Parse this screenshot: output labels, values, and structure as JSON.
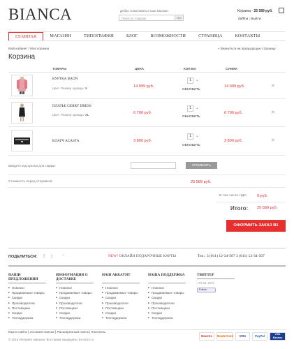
{
  "header": {
    "logo": "BIANCA",
    "welcome": "Добро пожаловать в наш магазин",
    "search_placeholder": "Поиск по товарам",
    "search_button": "GO",
    "cart_label": "Корзина -",
    "cart_total": "25 589 руб.",
    "user_name": "daffina",
    "logout": "Выйти"
  },
  "nav": {
    "items": [
      "ГЛАВНАЯ",
      "МАГАЗИН",
      "ТИПОГРАФИЯ",
      "БЛОГ",
      "ВОЗМОЖНОСТИ",
      "СТРАНИЦА",
      "КОНТАКТЫ"
    ]
  },
  "breadcrumb": "Мой кабинет / Моя корзина",
  "back_link": "« Вернуться на предыдущую страницу",
  "title": "Корзина",
  "table": {
    "headers": [
      "ТОВАРЫ",
      "ЦЕНА",
      "КОЛ-ВО",
      "СУММА"
    ],
    "rows": [
      {
        "name": "КУРТКА BAON",
        "meta_label": "Цвет: Размер одежды:",
        "meta_value": "S",
        "price": "14 999 руб.",
        "qty": "1",
        "plus": "+",
        "update": "ОБНОВИТЬ",
        "sum": "14 999 руб.",
        "remove": "✕"
      },
      {
        "name": "ПЛАТЬЕ GERRY DRESS",
        "meta_label": "Цвет: Размер одежды:",
        "meta_value": "XL",
        "price": "6 700 руб.",
        "qty": "1",
        "plus": "+",
        "update": "ОБНОВИТЬ",
        "sum": "6 700 руб.",
        "remove": "✕"
      },
      {
        "name": "КЛАТЧ ACASTA",
        "meta_label": "",
        "meta_value": "",
        "price": "3 890 руб.",
        "qty": "1",
        "plus": "+",
        "update": "ОБНОВИТЬ",
        "sum": "3 890 руб.",
        "remove": "✕"
      }
    ]
  },
  "coupon": {
    "label": "Введите код купона для скидки:",
    "placeholder": "",
    "apply": "ПРИМЕНИТЬ"
  },
  "summary": {
    "before_label": "Стоимость перед отправкой",
    "before_value": "25 589 руб.",
    "vat_label": "В том числе НДС:",
    "vat_value": "0 руб.",
    "total_label": "Итого:",
    "total_value": "25 589 руб.",
    "checkout": "ОФОРМИТЬ ЗАКАЗ В1"
  },
  "share": {
    "label": "ПОДЕЛИТЬСЯ:",
    "icons": [
      "f",
      "t",
      "rss"
    ],
    "gift_new": "NEW!",
    "gift_text": "ОНЛАЙН ПОДАРОЧНЫЕ КАРТЫ",
    "phones": "Тел.: 3 (011) 12-34-567   3 (011) 12-34-567"
  },
  "footer": {
    "cols": [
      {
        "head": [
          "НАШИ",
          "ПРЕДЛОЖЕНИЯ"
        ],
        "items": [
          "Новинки",
          "Продаваемые товары",
          "Скидки",
          "Производители",
          "Поставщики",
          "Скидки",
          "Техподдержка"
        ]
      },
      {
        "head": [
          "ИНФОРМАЦИЯ О",
          "ДОСТАВКЕ"
        ],
        "items": [
          "Новинки",
          "Продаваемые товары",
          "Скидки",
          "Производители",
          "Поставщики",
          "Скидки",
          "Техподдержка"
        ]
      },
      {
        "head": [
          "НАШ АККАУНТ",
          ""
        ],
        "items": [
          "Новинки",
          "Продаваемые товары",
          "Скидки",
          "Производители",
          "Поставщики",
          "Скидки",
          "Техподдержка"
        ]
      },
      {
        "head": [
          "НАША ПОДДЕРЖКА",
          ""
        ],
        "items": [
          "Новинки",
          "Продаваемые товары",
          "Скидки",
          "Производители",
          "Поставщики",
          "Скидки",
          "Техподдержка"
        ]
      }
    ],
    "twitter_head": "ТВИТТЕР",
    "twitter_date": "01.01.1970",
    "follow": "Follow",
    "links": "Карта сайта  |  Условия поиска  |  Расширенный поиск  |  Контакты",
    "copyright": "© 2015 Интернет магазин. Все права защищены. bx-store.ru",
    "payments": [
      "Maestro",
      "MasterCard",
      "VISA",
      "PayPal",
      "VISA Electron"
    ]
  },
  "colors": {
    "accent": "#e63030",
    "text": "#333333"
  }
}
